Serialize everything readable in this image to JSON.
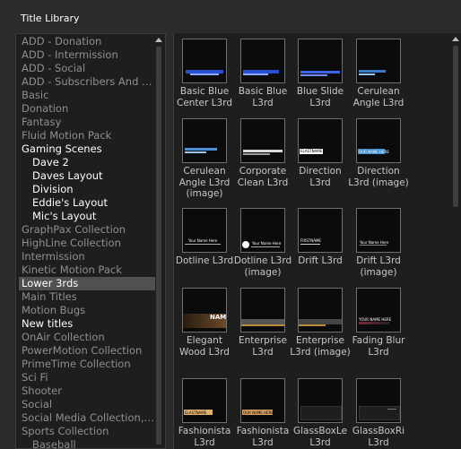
{
  "panel_title": "Title Library",
  "tree": [
    {
      "label": "ADD - Donation",
      "level": 0,
      "style": "dim"
    },
    {
      "label": "ADD - Intermission",
      "level": 0,
      "style": "dim"
    },
    {
      "label": "ADD - Social",
      "level": 0,
      "style": "dim"
    },
    {
      "label": "ADD - Subscribers And F...",
      "level": 0,
      "style": "dim"
    },
    {
      "label": "Basic",
      "level": 0,
      "style": "dim"
    },
    {
      "label": "Donation",
      "level": 0,
      "style": "dim"
    },
    {
      "label": "Fantasy",
      "level": 0,
      "style": "dim"
    },
    {
      "label": "Fluid Motion Pack",
      "level": 0,
      "style": "dim"
    },
    {
      "label": "Gaming Scenes",
      "level": 0,
      "style": "bright"
    },
    {
      "label": "Dave 2",
      "level": 1,
      "style": "bright"
    },
    {
      "label": "Daves Layout",
      "level": 1,
      "style": "bright"
    },
    {
      "label": "Division",
      "level": 1,
      "style": "bright"
    },
    {
      "label": "Eddie's Layout",
      "level": 1,
      "style": "bright"
    },
    {
      "label": "Mic's Layout",
      "level": 1,
      "style": "bright"
    },
    {
      "label": "GraphPax Collection",
      "level": 0,
      "style": "dim"
    },
    {
      "label": "HighLine Collection",
      "level": 0,
      "style": "dim"
    },
    {
      "label": "Intermission",
      "level": 0,
      "style": "dim"
    },
    {
      "label": "Kinetic Motion Pack",
      "level": 0,
      "style": "dim"
    },
    {
      "label": "Lower 3rds",
      "level": 0,
      "style": "selected"
    },
    {
      "label": "Main Titles",
      "level": 0,
      "style": "dim"
    },
    {
      "label": "Motion Bugs",
      "level": 0,
      "style": "dim"
    },
    {
      "label": "New titles",
      "level": 0,
      "style": "bright"
    },
    {
      "label": "OnAir Collection",
      "level": 0,
      "style": "dim"
    },
    {
      "label": "PowerMotion Collection",
      "level": 0,
      "style": "dim"
    },
    {
      "label": "PrimeTime Collection",
      "level": 0,
      "style": "dim"
    },
    {
      "label": "Sci Fi",
      "level": 0,
      "style": "dim"
    },
    {
      "label": "Shooter",
      "level": 0,
      "style": "dim"
    },
    {
      "label": "Social",
      "level": 0,
      "style": "dim"
    },
    {
      "label": "Social Media Collection, ...",
      "level": 0,
      "style": "dim"
    },
    {
      "label": "Sports Collection",
      "level": 0,
      "style": "dim"
    },
    {
      "label": "Baseball",
      "level": 1,
      "style": "dim"
    }
  ],
  "titles": [
    {
      "label": "Basic Blue Center L3rd",
      "thumb": "blue-center"
    },
    {
      "label": "Basic Blue L3rd",
      "thumb": "blue-left"
    },
    {
      "label": "Blue Slide L3rd",
      "thumb": "blue-slide"
    },
    {
      "label": "Cerulean Angle L3rd",
      "thumb": "cerulean"
    },
    {
      "label": "Cerulean Angle L3rd (image)",
      "thumb": "cerulean-image"
    },
    {
      "label": "Corporate Clean L3rd",
      "thumb": "corporate"
    },
    {
      "label": "Direction L3rd",
      "thumb": "direction",
      "mini": "ELASTNAME"
    },
    {
      "label": "Direction L3rd (image)",
      "thumb": "direction-image",
      "mini": "OUR NAME HERE"
    },
    {
      "label": "Dotline L3rd",
      "thumb": "dotline",
      "mini": "Your Name Here"
    },
    {
      "label": "Dotline L3rd (image)",
      "thumb": "dotline-image",
      "mini": "Your Name Here"
    },
    {
      "label": "Drift L3rd",
      "thumb": "drift",
      "mini": "FIRSTNAME"
    },
    {
      "label": "Drift L3rd (image)",
      "thumb": "drift-image",
      "mini": "Your Name Here"
    },
    {
      "label": "Elegant Wood L3rd",
      "thumb": "wood",
      "mini": "NAM"
    },
    {
      "label": "Enterprise L3rd",
      "thumb": "enterprise"
    },
    {
      "label": "Enterprise L3rd (image)",
      "thumb": "enterprise-image"
    },
    {
      "label": "Fading Blur L3rd",
      "thumb": "fading",
      "mini": "YOUR NAME HERE"
    },
    {
      "label": "Fashionista L3rd",
      "thumb": "fashion",
      "mini": "ELASTNAME"
    },
    {
      "label": "Fashionista L3rd",
      "thumb": "fashion2",
      "mini": "OUR NAME HERE"
    },
    {
      "label": "GlassBoxLe L3rd",
      "thumb": "glassleft"
    },
    {
      "label": "GlassBoxRi L3rd",
      "thumb": "glassright"
    }
  ]
}
